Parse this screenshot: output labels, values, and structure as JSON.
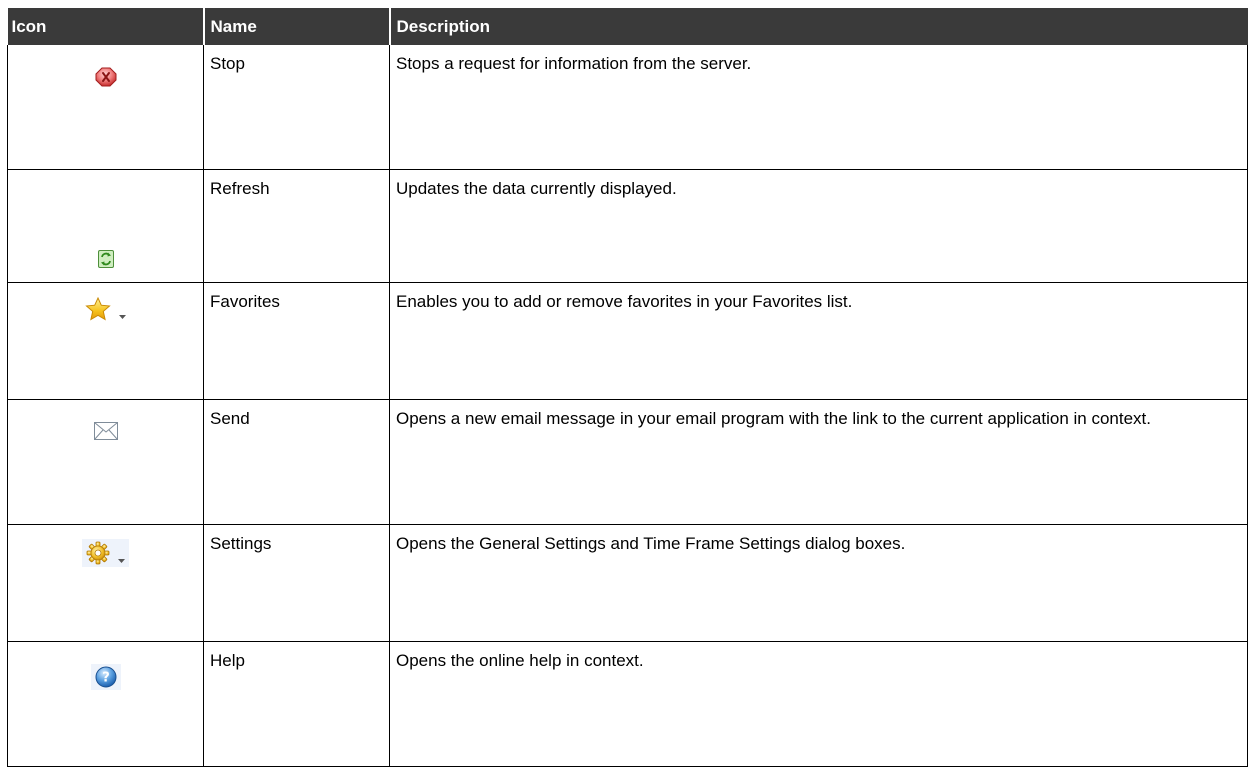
{
  "table": {
    "headers": {
      "icon": "Icon",
      "name": "Name",
      "description": "Description"
    },
    "rows": [
      {
        "icon": "stop-icon",
        "name": "Stop",
        "description": "Stops a request for information from the server."
      },
      {
        "icon": "refresh-icon",
        "name": "Refresh",
        "description": "Updates the data currently displayed."
      },
      {
        "icon": "favorites-star-icon",
        "name": "Favorites",
        "description": "Enables you to add or remove favorites in your Favorites list."
      },
      {
        "icon": "envelope-icon",
        "name": "Send",
        "description": "Opens a new email message in your email program with the link to the current application in context."
      },
      {
        "icon": "gear-icon",
        "name": "Settings",
        "description": "Opens the General Settings and Time Frame Settings dialog boxes."
      },
      {
        "icon": "help-icon",
        "name": "Help",
        "description": "Opens the online help in context."
      }
    ]
  },
  "colors": {
    "header_background": "#3a3a3a",
    "header_text": "#ffffff",
    "border": "#000000"
  }
}
